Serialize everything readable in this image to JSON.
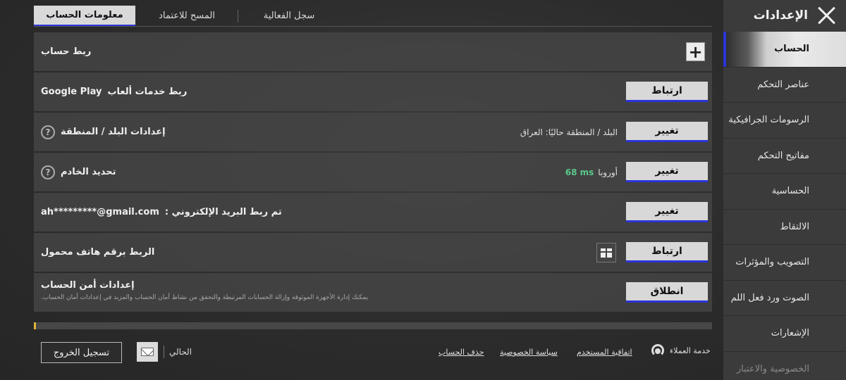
{
  "sidebar": {
    "title": "الإعدادات",
    "items": [
      {
        "label": "الحساب"
      },
      {
        "label": "عناصر التحكم"
      },
      {
        "label": "الرسومات الجرافيكية"
      },
      {
        "label": "مفاتيح التحكم"
      },
      {
        "label": "الحساسية"
      },
      {
        "label": "الالتقاط"
      },
      {
        "label": "التصويب والمؤثرات"
      },
      {
        "label": "الصوت ورد فعل اللم"
      },
      {
        "label": "الإشعارات"
      },
      {
        "label": "الخصوصية والاعتبار"
      }
    ]
  },
  "tabs": [
    {
      "label": "معلومات الحساب"
    },
    {
      "label": "المسح للاعتماد"
    },
    {
      "label": "سجل الفعالية"
    }
  ],
  "rows": {
    "link_account": {
      "label": "ربط حساب"
    },
    "google_play": {
      "label": "ربط خدمات ألعاب",
      "brand": "Google Play",
      "button": "ارتباط"
    },
    "region": {
      "label": "إعدادات البلد / المنطقة",
      "info": "البلد / المنطقة حاليًا: العراق",
      "button": "تغيير"
    },
    "server": {
      "label": "تحديد الخادم",
      "region": "أوروبا",
      "ping": "68 ms",
      "button": "تغيير"
    },
    "email": {
      "label": "تم ربط البريد الإلكتروني :",
      "value": "ah*********@gmail.com",
      "button": "تغيير"
    },
    "phone": {
      "label": "الربط برقم هاتف محمول",
      "button": "ارتباط"
    },
    "security": {
      "title": "إعدادات أمن الحساب",
      "desc": "يمكنك إدارة الأجهزة الموثوقة وإزالة الحسابات المرتبطة والتحقق من نشاط أمان الحساب والمزيد في إعدادات أمان الحساب.",
      "button": "انطلاق"
    }
  },
  "progress": {
    "fraction": 0.003,
    "color": "#e0b13a"
  },
  "footer": {
    "logout": "تسجيل الخروج",
    "current": "الحالي",
    "links": {
      "delete_account": "حذف الحساب",
      "privacy": "سياسة الخصوصية",
      "user_agreement": "اتفاقية المستخدم"
    },
    "support": "خدمة العملاء"
  },
  "colors": {
    "accent": "#2a34d8",
    "ping": "#5bc98a"
  }
}
